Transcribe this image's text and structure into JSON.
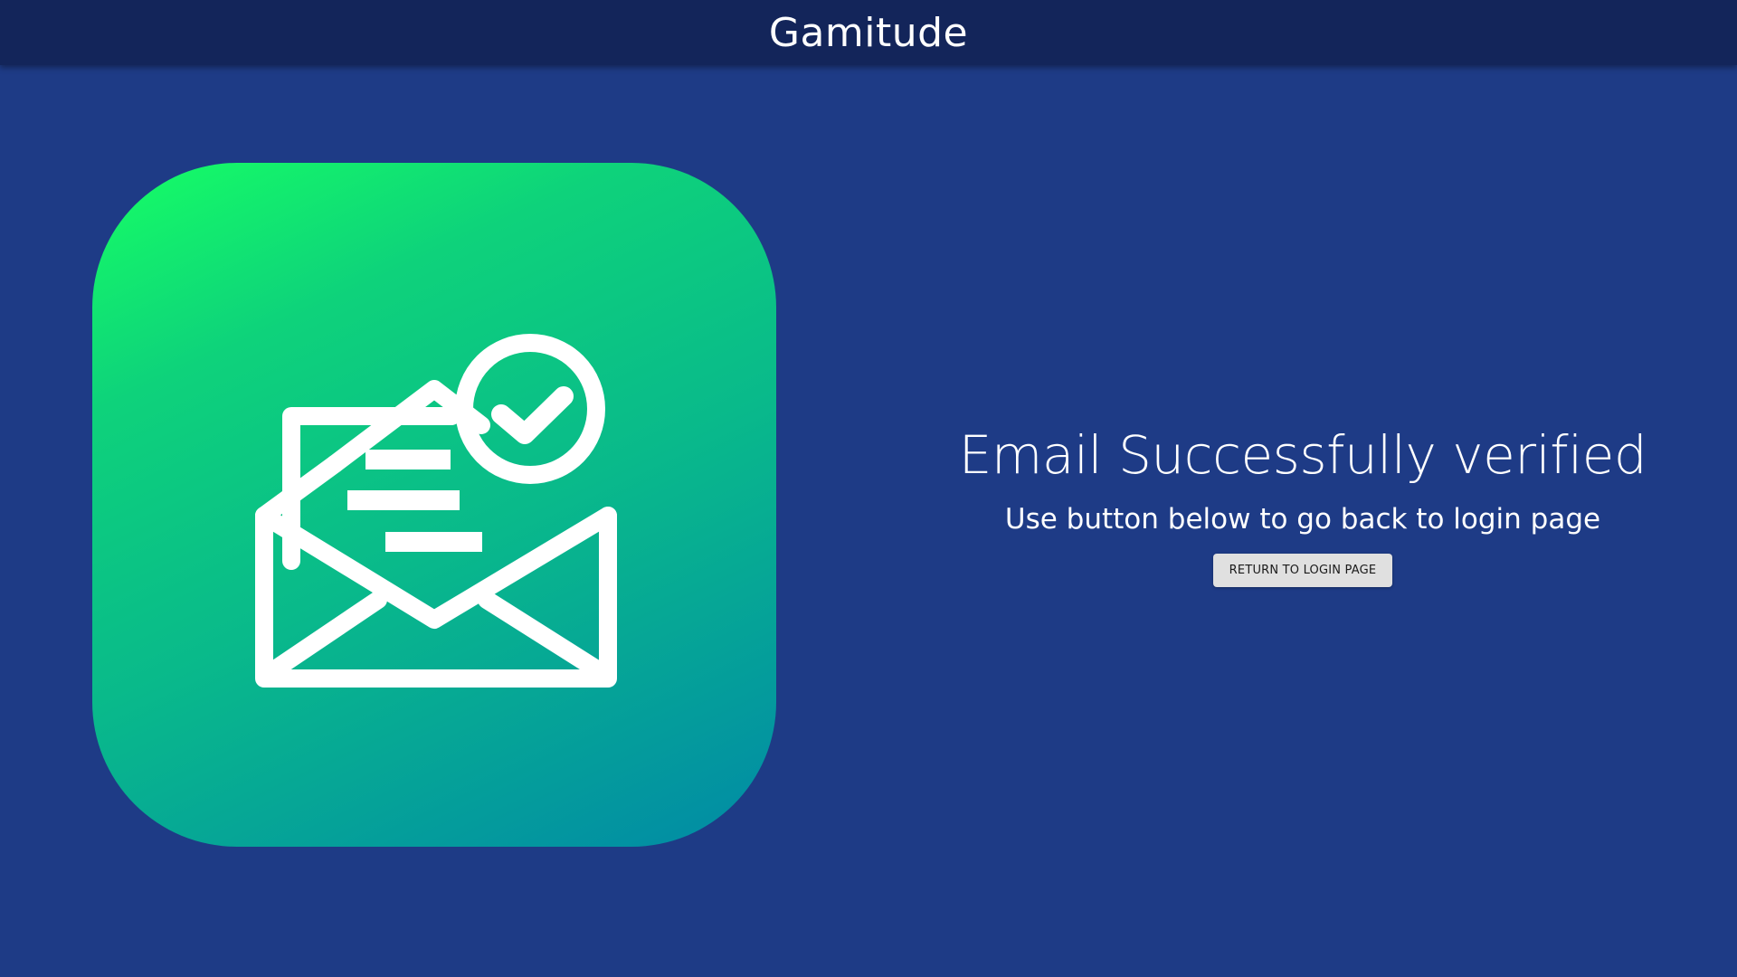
{
  "header": {
    "title": "Gamitude"
  },
  "illustration": {
    "icon": "envelope-check-icon",
    "colors": {
      "gradient_start": "#16ff65",
      "gradient_end": "#018aa6"
    }
  },
  "message": {
    "title": "Email Successfully verified",
    "subtitle": "Use button below to go back to login page",
    "button_label": "RETURN TO LOGIN PAGE"
  },
  "colors": {
    "background": "#1e3b86",
    "header": "#13255a",
    "button": "#e0e0e0"
  }
}
